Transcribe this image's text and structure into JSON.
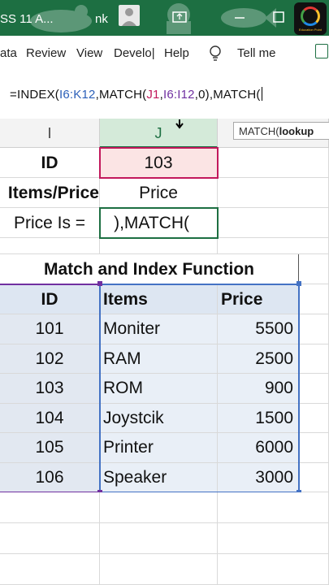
{
  "titlebar": {
    "file_title": "SS 11 A...",
    "user_fragment": "nk"
  },
  "ribbon": {
    "tabs": [
      "ata",
      "Review",
      "View",
      "Develo|",
      "Help"
    ],
    "tell_me": "Tell me"
  },
  "formula_bar": {
    "parts": [
      "=INDEX(",
      "I6:K12",
      ",MATCH(",
      "J1",
      ",",
      "I6:I12",
      ",0),MATCH("
    ]
  },
  "columns": [
    "I",
    "J"
  ],
  "tooltip": {
    "fn": "MATCH(",
    "arg": "lookup"
  },
  "lookup": {
    "id_label": "ID",
    "id_value": "103",
    "items_label": "Items/Price",
    "items_value": "Price",
    "result_label": "Price Is =",
    "result_value": "),MATCH("
  },
  "table": {
    "title": "Match and Index Function",
    "headers": [
      "ID",
      "Items",
      "Price"
    ],
    "rows": [
      [
        "101",
        "Moniter",
        "5500"
      ],
      [
        "102",
        "RAM",
        "2500"
      ],
      [
        "103",
        "ROM",
        "900"
      ],
      [
        "104",
        "Joystcik",
        "1500"
      ],
      [
        "105",
        "Printer",
        "6000"
      ],
      [
        "106",
        "Speaker",
        "3000"
      ]
    ]
  },
  "colors": {
    "excel_green": "#1d6f42",
    "ref_blue": "#2b5fb8",
    "ref_purple": "#7030a0",
    "ref_pink": "#c2185b",
    "id_cell_fill": "#fbe4e4",
    "table_header_fill": "#dde6f2",
    "table_body_fill": "#e9eff7",
    "id_col_fill": "#e2e8f1"
  }
}
